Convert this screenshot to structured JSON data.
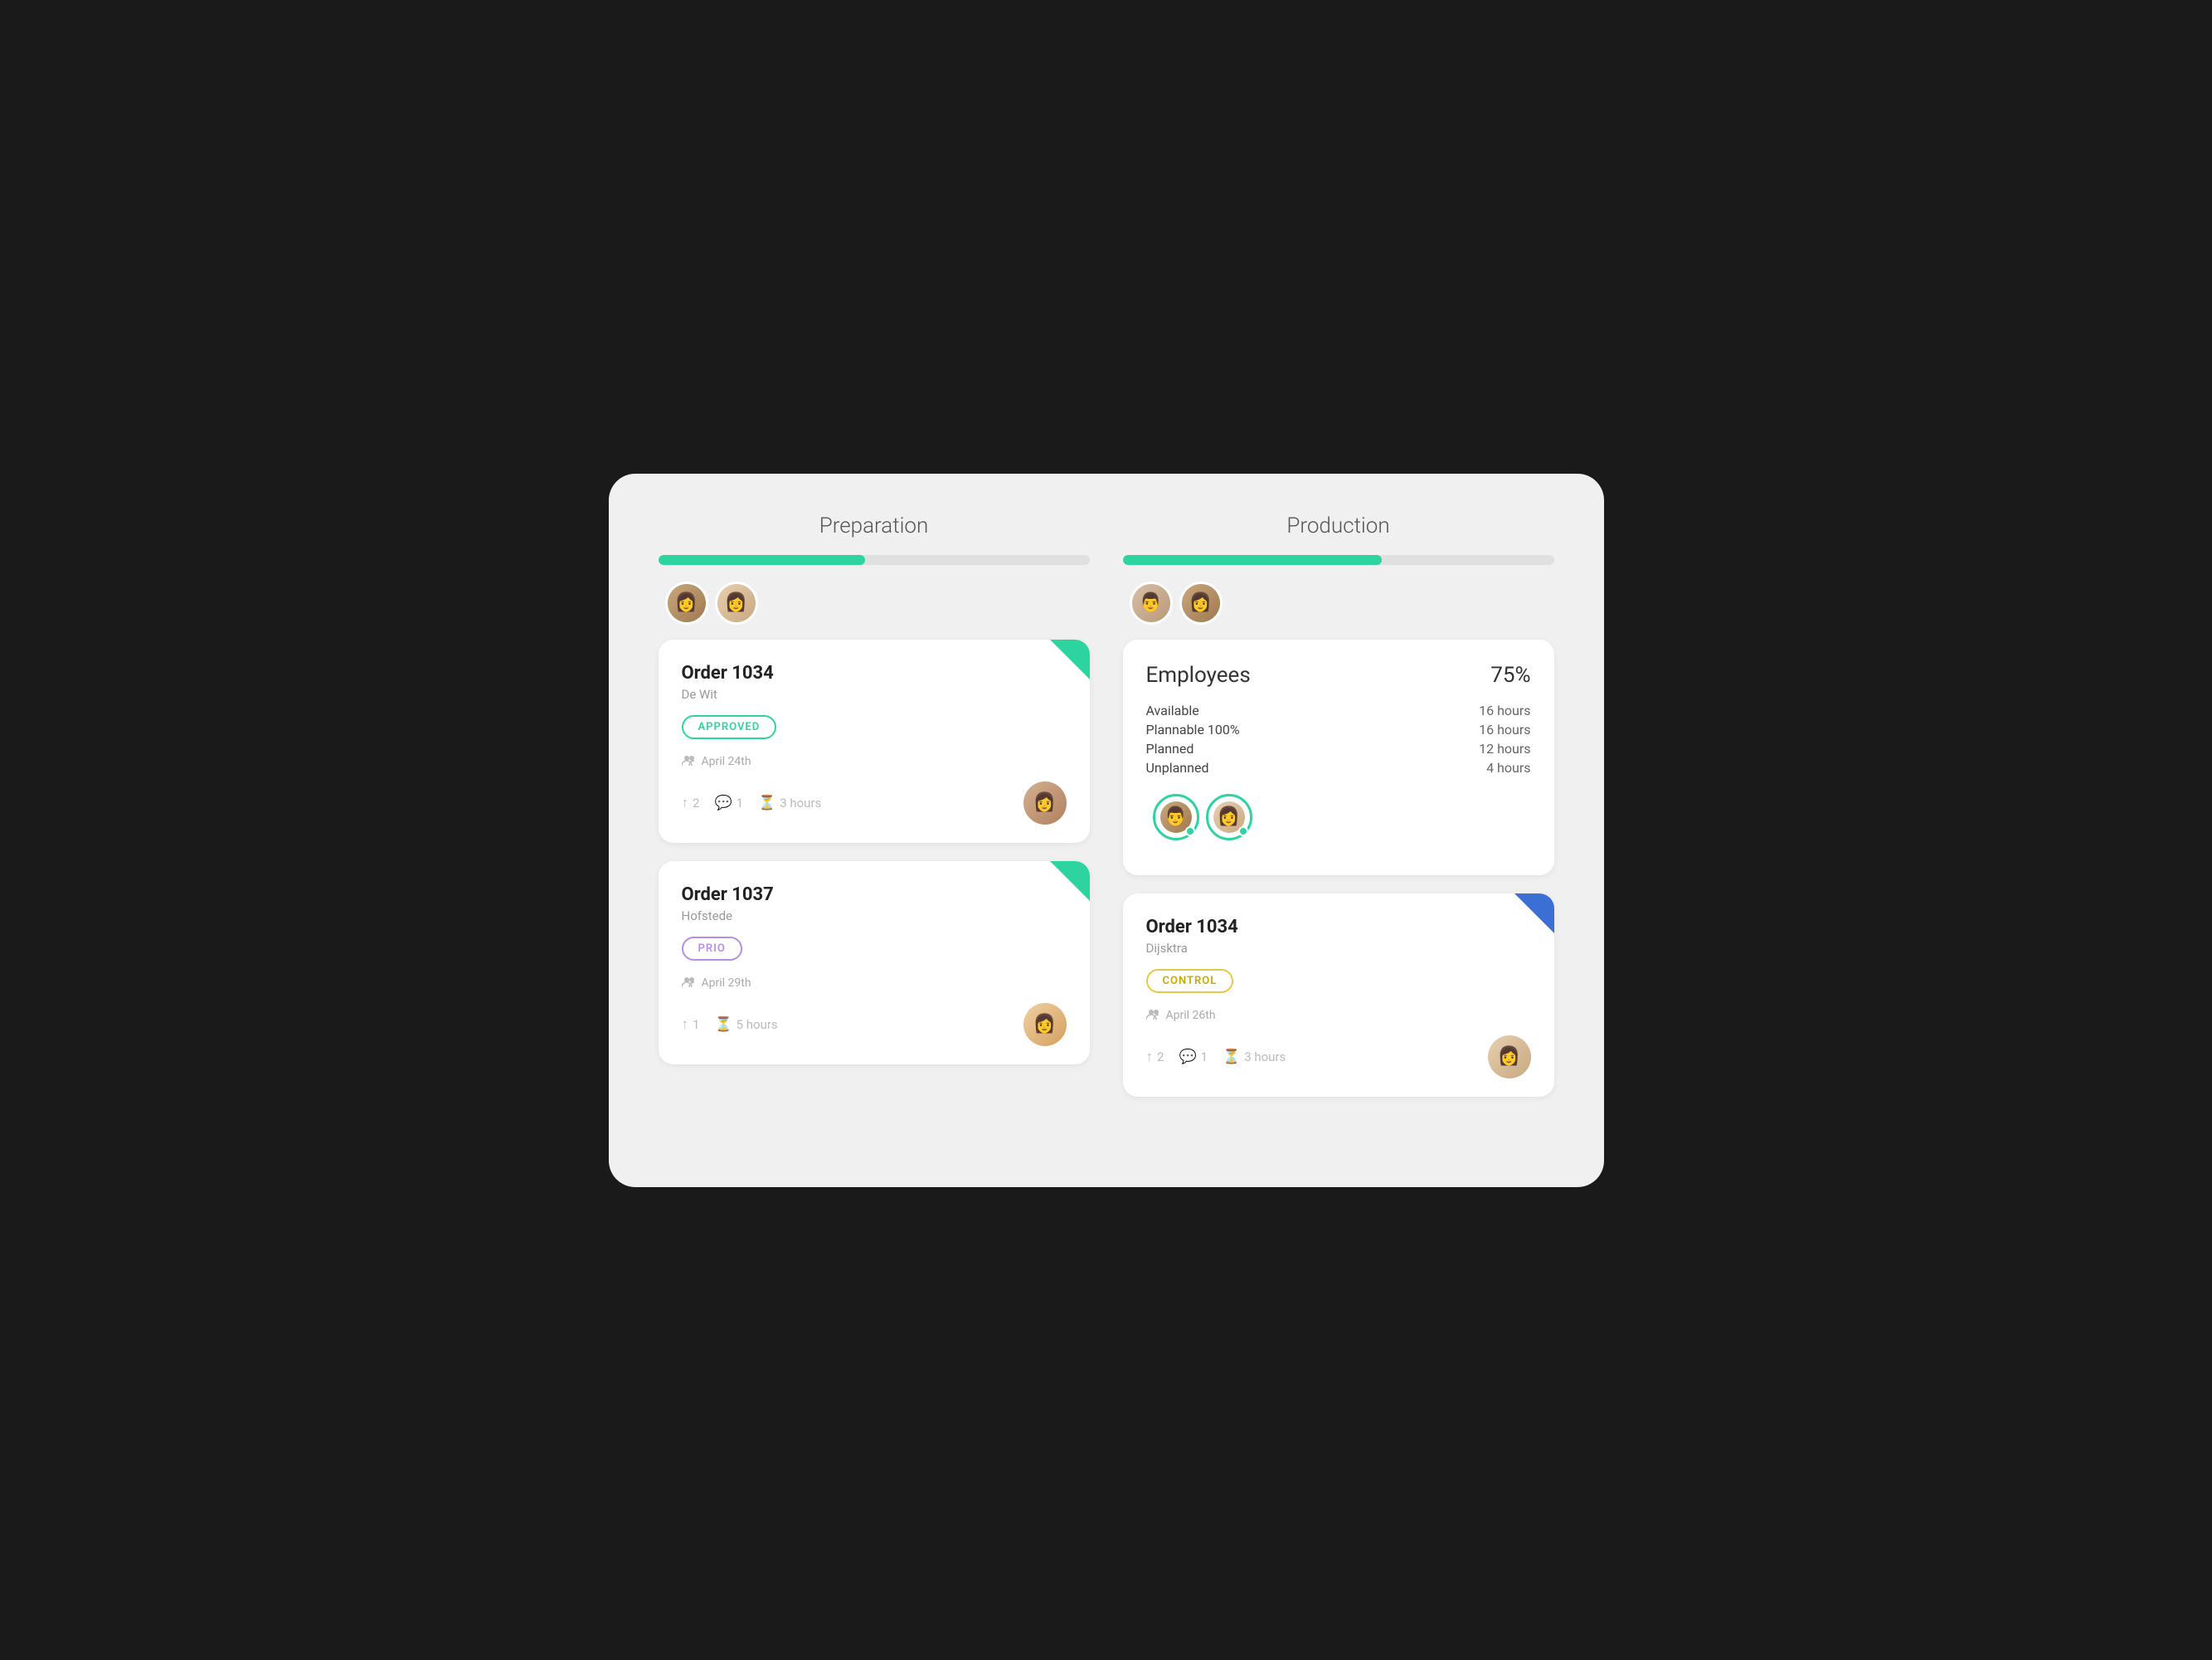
{
  "preparation": {
    "title": "Preparation",
    "progress": 48,
    "avatars": [
      {
        "id": "prep-avatar-1",
        "face": "face-1"
      },
      {
        "id": "prep-avatar-2",
        "face": "face-2"
      }
    ],
    "cards": [
      {
        "id": "prep-card-1",
        "title": "Order 1034",
        "subtitle": "De Wit",
        "badge": "APPROVED",
        "badge_type": "approved",
        "meta_date": "April 24th",
        "stats_up": "2",
        "stats_chat": "1",
        "stats_time": "3 hours",
        "corner": "green",
        "avatar_face": "face-3"
      },
      {
        "id": "prep-card-2",
        "title": "Order 1037",
        "subtitle": "Hofstede",
        "badge": "PRIO",
        "badge_type": "prio",
        "meta_date": "April 29th",
        "stats_up": "1",
        "stats_chat": null,
        "stats_time": "5 hours",
        "corner": "green",
        "avatar_face": "face-4"
      }
    ]
  },
  "production": {
    "title": "Production",
    "progress": 60,
    "avatars": [
      {
        "id": "prod-avatar-1",
        "face": "face-5"
      },
      {
        "id": "prod-avatar-2",
        "face": "face-1"
      }
    ],
    "employees_card": {
      "title": "Employees",
      "percentage": "75%",
      "rows": [
        {
          "label": "Available",
          "value": "16 hours"
        },
        {
          "label": "Plannable 100%",
          "value": "16 hours"
        },
        {
          "label": "Planned",
          "value": "12 hours"
        },
        {
          "label": "Unplanned",
          "value": "4 hours"
        }
      ]
    },
    "cards": [
      {
        "id": "prod-card-1",
        "title": "Order 1034",
        "subtitle": "Dijsktra",
        "badge": "CONTROL",
        "badge_type": "control",
        "meta_date": "April 26th",
        "stats_up": "2",
        "stats_chat": "1",
        "stats_time": "3 hours",
        "corner": "blue",
        "avatar_face": "face-2"
      }
    ]
  }
}
